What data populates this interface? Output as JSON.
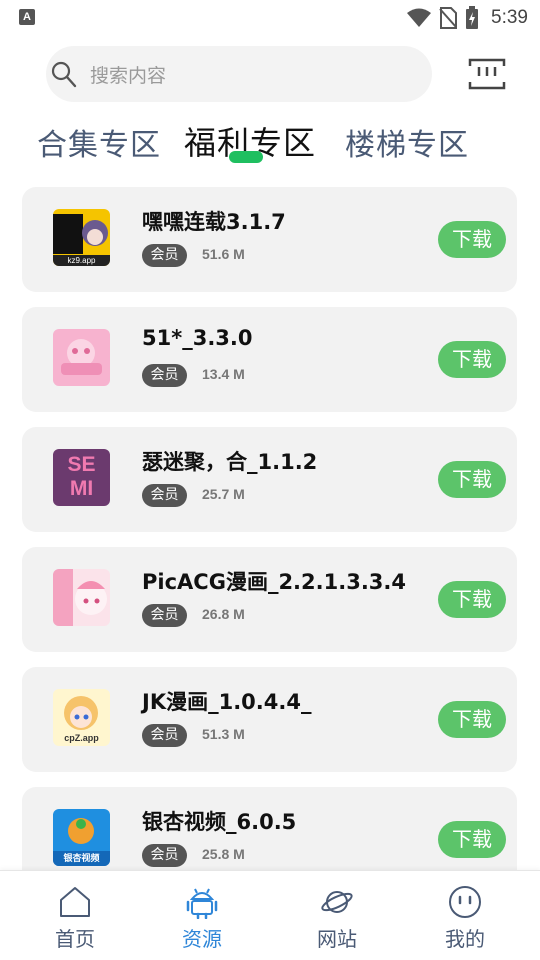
{
  "status_bar": {
    "time": "5:39",
    "left_icon": "A",
    "icons": [
      "wifi-icon",
      "no-sim-icon",
      "battery-charging-icon"
    ]
  },
  "search": {
    "placeholder": "搜索内容"
  },
  "tabs": [
    {
      "label": "合集专区",
      "active": false
    },
    {
      "label": "福利专区",
      "active": true
    },
    {
      "label": "楼梯专区",
      "active": false
    }
  ],
  "apps": [
    {
      "name": "嘿嘿连载3.1.7",
      "badge": "会员",
      "size": "51.6 M",
      "button": "下载",
      "icon_text": "kz9.app"
    },
    {
      "name": "51*_3.3.0",
      "badge": "会员",
      "size": "13.4 M",
      "button": "下载",
      "icon_text": ""
    },
    {
      "name": "瑟迷聚，合_1.1.2",
      "badge": "会员",
      "size": "25.7 M",
      "button": "下载",
      "icon_text": "SE MI"
    },
    {
      "name": "PicACG漫画_2.2.1.3.3.4",
      "badge": "会员",
      "size": "26.8 M",
      "button": "下载",
      "icon_text": ""
    },
    {
      "name": "JK漫画_1.0.4.4_",
      "badge": "会员",
      "size": "51.3 M",
      "button": "下载",
      "icon_text": "cpZ.app"
    },
    {
      "name": "银杏视频_6.0.5",
      "badge": "会员",
      "size": "25.8 M",
      "button": "下载",
      "icon_text": "银杏视频"
    }
  ],
  "bottom_nav": [
    {
      "label": "首页",
      "icon": "home-icon",
      "active": false
    },
    {
      "label": "资源",
      "icon": "android-icon",
      "active": true
    },
    {
      "label": "网站",
      "icon": "planet-icon",
      "active": false
    },
    {
      "label": "我的",
      "icon": "face-icon",
      "active": false
    }
  ],
  "colors": {
    "accent_green": "#5cc46a",
    "tab_indicator": "#1fbf60",
    "active_nav": "#2f86d8",
    "inactive_text": "#4a5a75"
  }
}
